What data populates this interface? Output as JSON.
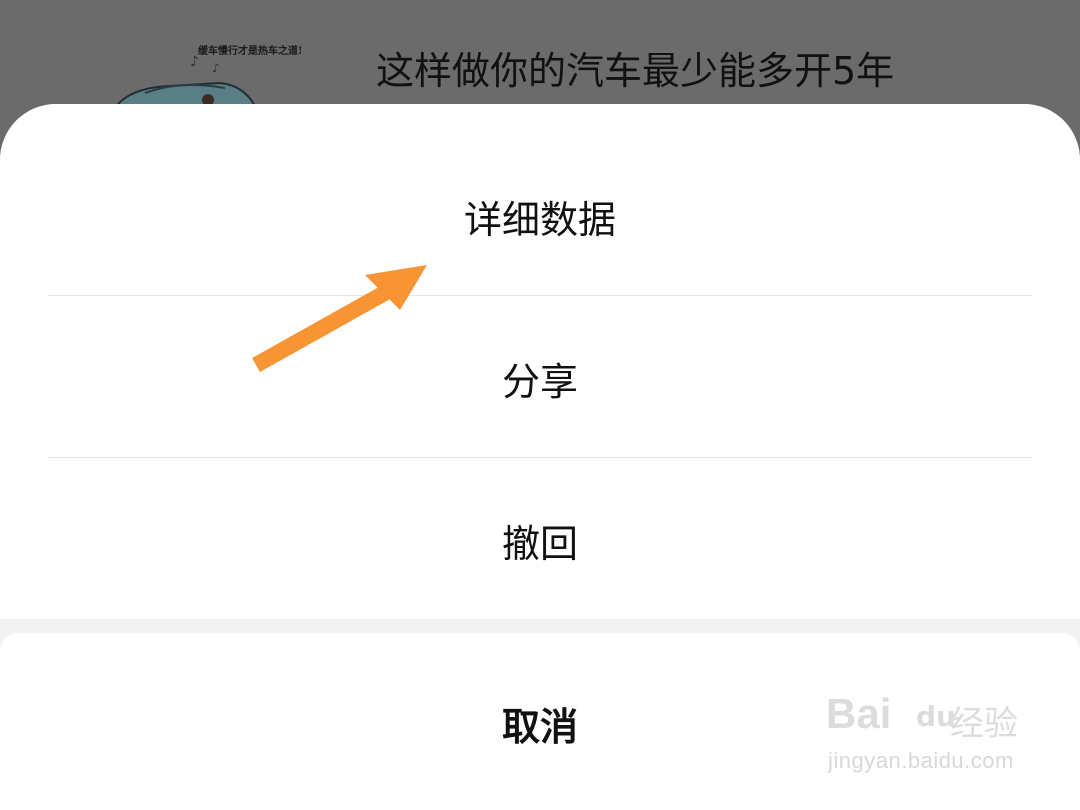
{
  "background_article": {
    "thumbnail_caption": "缓车慢行才是热车之道!",
    "title": "这样做你的汽车最少能多开5年"
  },
  "action_sheet": {
    "items": [
      {
        "label": "详细数据"
      },
      {
        "label": "分享"
      },
      {
        "label": "撤回"
      }
    ],
    "cancel_label": "取消"
  },
  "annotation": {
    "arrow_color": "#f79433",
    "points_to": "详细数据"
  },
  "watermark": {
    "brand_latin": "Bai",
    "brand_du": "du",
    "brand_cn": "经验",
    "url": "jingyan.baidu.com"
  },
  "colors": {
    "overlay": "#6b6b6b",
    "sheet": "#ffffff",
    "divider": "#e6e6e6",
    "gap": "#f2f2f2"
  }
}
